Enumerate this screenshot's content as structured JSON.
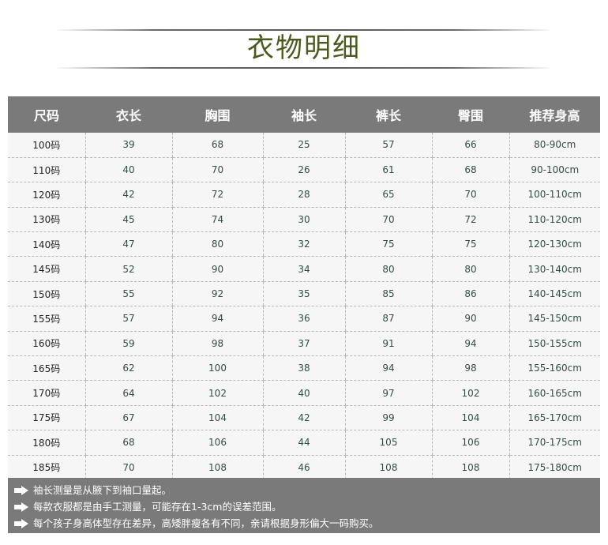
{
  "title": "衣物明细",
  "table": {
    "headers": [
      "尺码",
      "衣长",
      "胸围",
      "袖长",
      "裤长",
      "臀围",
      "推荐身高"
    ],
    "rows": [
      [
        "100码",
        "39",
        "68",
        "25",
        "57",
        "66",
        "80-90cm"
      ],
      [
        "110码",
        "40",
        "70",
        "26",
        "61",
        "68",
        "90-100cm"
      ],
      [
        "120码",
        "42",
        "72",
        "28",
        "65",
        "70",
        "100-110cm"
      ],
      [
        "130码",
        "45",
        "74",
        "30",
        "70",
        "72",
        "110-120cm"
      ],
      [
        "140码",
        "47",
        "80",
        "32",
        "75",
        "75",
        "120-130cm"
      ],
      [
        "145码",
        "52",
        "90",
        "34",
        "80",
        "80",
        "130-140cm"
      ],
      [
        "150码",
        "55",
        "92",
        "35",
        "85",
        "86",
        "140-145cm"
      ],
      [
        "155码",
        "57",
        "94",
        "36",
        "87",
        "90",
        "145-150cm"
      ],
      [
        "160码",
        "59",
        "98",
        "37",
        "91",
        "94",
        "150-155cm"
      ],
      [
        "165码",
        "62",
        "100",
        "38",
        "94",
        "98",
        "155-160cm"
      ],
      [
        "170码",
        "64",
        "102",
        "40",
        "97",
        "102",
        "160-165cm"
      ],
      [
        "175码",
        "67",
        "104",
        "42",
        "99",
        "104",
        "165-170cm"
      ],
      [
        "180码",
        "68",
        "106",
        "44",
        "105",
        "106",
        "170-175cm"
      ],
      [
        "185码",
        "70",
        "108",
        "46",
        "108",
        "108",
        "175-180cm"
      ]
    ]
  },
  "notes": [
    {
      "icon": "arrow-right-icon",
      "text": "袖长测量是从腋下到袖口量起。"
    },
    {
      "icon": "arrow-right-icon",
      "text": "每款衣服都是由手工测量，可能存在1-3cm的误差范围。"
    },
    {
      "icon": "arrow-right-icon",
      "text": "每个孩子身高体型存在差异，高矮胖瘦各有不同，亲请根据身形偏大一码购买。"
    }
  ],
  "colors": {
    "header_bg": "#7a7a7a",
    "title_color": "#4a5a1e",
    "cell_text": "#2f4f3f"
  }
}
